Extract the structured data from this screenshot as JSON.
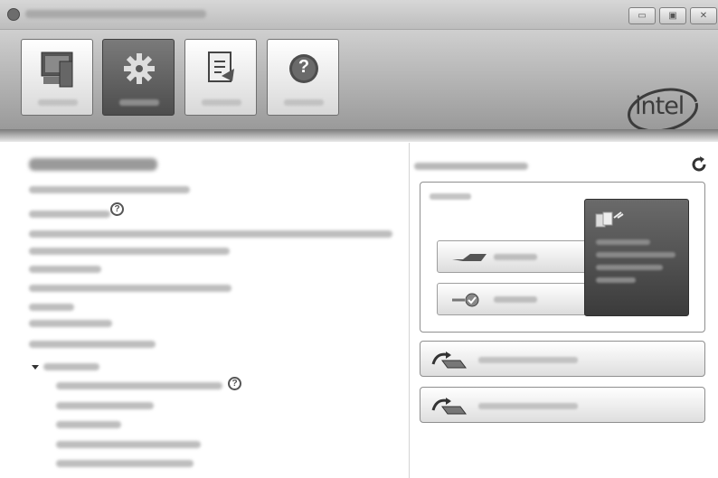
{
  "brand": {
    "logo_text": "intel",
    "accent": "#3c3c3c"
  },
  "window": {
    "minimize_glyph": "▭",
    "maximize_glyph": "▣",
    "close_glyph": "✕"
  },
  "toolbar": {
    "tiles": [
      {
        "icon": "status-monitor-icon",
        "active": false
      },
      {
        "icon": "manage-gear-icon",
        "active": true
      },
      {
        "icon": "performance-icon",
        "active": false
      },
      {
        "icon": "help-icon",
        "active": false,
        "glyph": "?"
      }
    ]
  },
  "left_pane": {
    "help_glyph": "?"
  },
  "right_pane": {
    "refresh_icon": "refresh-icon"
  }
}
